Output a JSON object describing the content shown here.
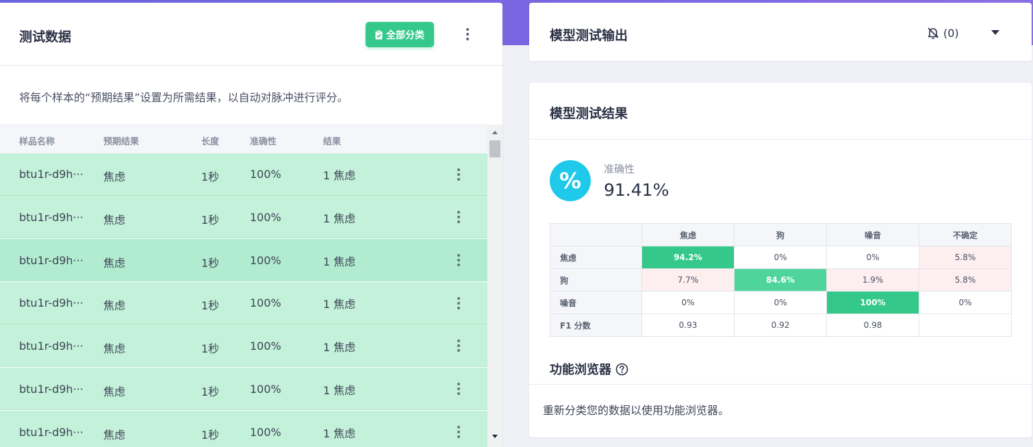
{
  "colors": {
    "accent_green": "#34c98a",
    "row_green": "#c3f1d9",
    "header_purple": "#6b64df",
    "percent_icon": "#1ec9ea",
    "misclass_pink": "#fdeef0"
  },
  "test_data": {
    "title": "测试数据",
    "classify_all_label": "全部分类",
    "classify_icon": "clipboard-check-icon",
    "description": "将每个样本的“预期结果”设置为所需结果，以自动对脉冲进行评分。",
    "columns": [
      "样品名称",
      "预期结果",
      "长度",
      "准确性",
      "结果"
    ],
    "rows": [
      {
        "name": "btu1r-d9h···",
        "expected": "焦虑",
        "length": "1秒",
        "accuracy": "100%",
        "result": "1 焦虑"
      },
      {
        "name": "btu1r-d9h···",
        "expected": "焦虑",
        "length": "1秒",
        "accuracy": "100%",
        "result": "1 焦虑"
      },
      {
        "name": "btu1r-d9h···",
        "expected": "焦虑",
        "length": "1秒",
        "accuracy": "100%",
        "result": "1 焦虑"
      },
      {
        "name": "btu1r-d9h···",
        "expected": "焦虑",
        "length": "1秒",
        "accuracy": "100%",
        "result": "1 焦虑"
      },
      {
        "name": "btu1r-d9h···",
        "expected": "焦虑",
        "length": "1秒",
        "accuracy": "100%",
        "result": "1 焦虑"
      },
      {
        "name": "btu1r-d9h···",
        "expected": "焦虑",
        "length": "1秒",
        "accuracy": "100%",
        "result": "1 焦虑"
      },
      {
        "name": "btu1r-d9h···",
        "expected": "焦虑",
        "length": "1秒",
        "accuracy": "100%",
        "result": "1 焦虑"
      }
    ]
  },
  "model_output": {
    "title": "模型测试输出",
    "notification_count": "(0)",
    "notification_icon": "bell-off-icon"
  },
  "model_results": {
    "title": "模型测试结果",
    "accuracy_label": "准确性",
    "accuracy_value": "91.41%",
    "accuracy_icon_glyph": "%",
    "confusion_matrix": {
      "columns": [
        "焦虑",
        "狗",
        "噪音",
        "不确定"
      ],
      "rows": [
        {
          "label": "焦虑",
          "cells": [
            "94.2%",
            "0%",
            "0%",
            "5.8%"
          ]
        },
        {
          "label": "狗",
          "cells": [
            "7.7%",
            "84.6%",
            "1.9%",
            "5.8%"
          ]
        },
        {
          "label": "噪音",
          "cells": [
            "0%",
            "0%",
            "100%",
            "0%"
          ]
        },
        {
          "label": "F1 分数",
          "cells": [
            "0.93",
            "0.92",
            "0.98",
            ""
          ]
        }
      ]
    },
    "feature_explorer": {
      "title": "功能浏览器",
      "help_icon": "question-circle-icon",
      "message": "重新分类您的数据以使用功能浏览器。"
    }
  }
}
